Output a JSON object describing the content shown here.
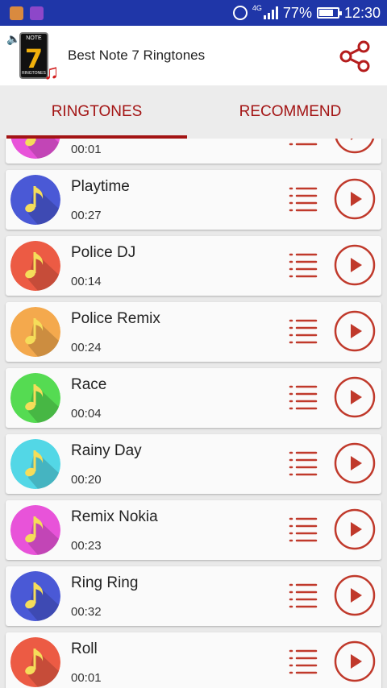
{
  "status_bar": {
    "network": "4G",
    "battery": "77%",
    "battery_level": 0.77,
    "time": "12:30",
    "icons": [
      "notification-app-icon",
      "notification-gallery-icon",
      "alarm-icon",
      "signal-icon",
      "battery-icon"
    ]
  },
  "app_bar": {
    "title": "Best Note 7 Ringtones",
    "logo": {
      "top_text": "NOTE",
      "number": "7",
      "bottom_text": "RINGTONES"
    },
    "share_icon": "share-icon"
  },
  "tabs": [
    {
      "label": "RINGTONES",
      "active": true
    },
    {
      "label": "RECOMMEND",
      "active": false
    }
  ],
  "colors": {
    "accent": "#a31414",
    "status_bar": "#1f36a8"
  },
  "ringtones": [
    {
      "name": "",
      "duration": "00:01",
      "color": "#e853d9"
    },
    {
      "name": "Playtime",
      "duration": "00:27",
      "color": "#4a59d6"
    },
    {
      "name": "Police DJ",
      "duration": "00:14",
      "color": "#ec5b44"
    },
    {
      "name": "Police Remix",
      "duration": "00:24",
      "color": "#f4a94d"
    },
    {
      "name": "Race",
      "duration": "00:04",
      "color": "#55db52"
    },
    {
      "name": "Rainy Day",
      "duration": "00:20",
      "color": "#53d7e6"
    },
    {
      "name": "Remix Nokia",
      "duration": "00:23",
      "color": "#e853d9"
    },
    {
      "name": "Ring Ring",
      "duration": "00:32",
      "color": "#4a59d6"
    },
    {
      "name": "Roll",
      "duration": "00:01",
      "color": "#ec5b44"
    }
  ]
}
